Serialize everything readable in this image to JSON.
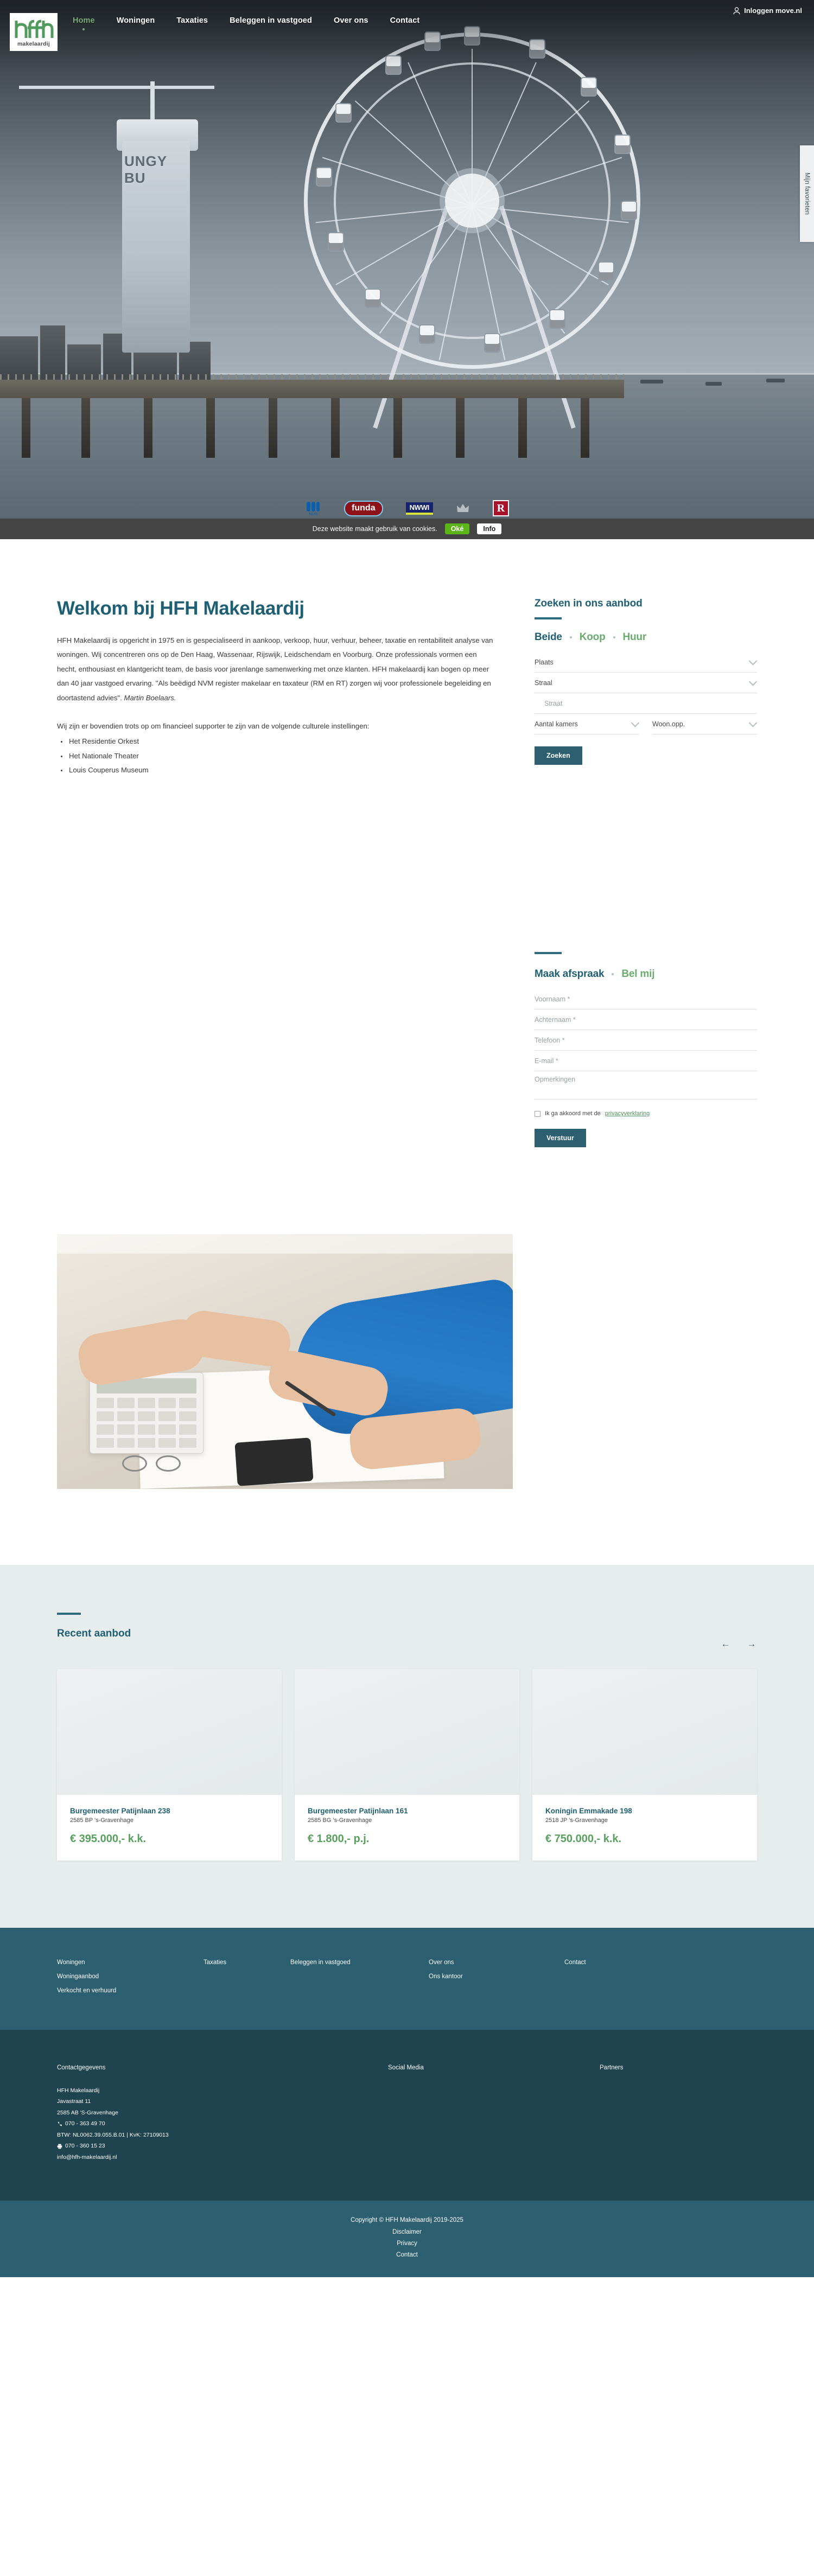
{
  "site": {
    "logo_mark": "hfh",
    "logo_word": "makelaardij"
  },
  "nav": {
    "items": [
      {
        "label": "Home",
        "active": true
      },
      {
        "label": "Woningen",
        "active": false
      },
      {
        "label": "Taxaties",
        "active": false
      },
      {
        "label": "Beleggen in vastgoed",
        "active": false
      },
      {
        "label": "Over ons",
        "active": false
      },
      {
        "label": "Contact",
        "active": false
      }
    ],
    "login_label": "Inloggen move.nl",
    "login_icon": "user-icon"
  },
  "favorites_tab": {
    "label": "Mijn favorieten"
  },
  "hero": {
    "tower_text": "UNGY BU",
    "partners": [
      {
        "name": "NVM",
        "type": "nvm"
      },
      {
        "name": "funda",
        "type": "funda"
      },
      {
        "name": "NWWI",
        "type": "nwwi"
      },
      {
        "name": "vastgoedcert gecertificeerd",
        "type": "vgc"
      },
      {
        "name": "R",
        "type": "r"
      }
    ]
  },
  "cookiebar": {
    "text": "Deze website maakt gebruik van cookies.",
    "ok_label": "Oké",
    "info_label": "Info"
  },
  "welcome": {
    "title": "Welkom bij HFH Makelaardij",
    "paragraph": "HFH Makelaardij is opgericht in 1975 en is gespecialiseerd in aankoop, verkoop, huur, verhuur, beheer, taxatie en rentabiliteit analyse van woningen. Wij concentreren ons op de Den Haag, Wassenaar, Rijswijk, Leidschendam en Voorburg. Onze professionals vormen een hecht, enthousiast en klantgericht team, de basis voor jarenlange samenwerking met onze klanten. HFH makelaardij kan bogen op meer dan 40 jaar vastgoed ervaring. \"Als beëdigd NVM register makelaar en taxateur (RM en RT) zorgen wij voor professionele begeleiding en doortastend advies\". ",
    "signature": "Martin Boelaars.",
    "culture_intro": "Wij zijn er bovendien trots op om financieel supporter te zijn van de volgende culturele instellingen:",
    "culture_items": [
      "Het Residentie Orkest",
      "Het Nationale Theater",
      "Louis Couperus Museum"
    ]
  },
  "search_widget": {
    "title": "Zoeken in ons aanbod",
    "tabs": [
      {
        "label": "Beide",
        "selected": true
      },
      {
        "label": "Koop",
        "selected": false
      },
      {
        "label": "Huur",
        "selected": false
      }
    ],
    "fields": {
      "plaats": "Plaats",
      "straal": "Straal",
      "straat_placeholder": "Straat",
      "kamers": "Aantal kamers",
      "woonopp": "Woon.opp."
    },
    "submit_label": "Zoeken"
  },
  "appointment_widget": {
    "tabs": [
      {
        "label": "Maak afspraak",
        "selected": true
      },
      {
        "label": "Bel mij",
        "selected": false
      }
    ],
    "fields": {
      "voornaam": "Voornaam *",
      "achternaam": "Achternaam *",
      "telefoon": "Telefoon *",
      "email": "E-mail *",
      "opmerkingen": "Opmerkingen"
    },
    "consent_text": "Ik ga akkoord met de",
    "consent_link": "privacyverklaring",
    "submit_label": "Verstuur"
  },
  "recent": {
    "title": "Recent aanbod",
    "prev_icon": "arrow-left-icon",
    "next_icon": "arrow-right-icon",
    "cards": [
      {
        "address": "Burgemeester Patijnlaan 238",
        "zip": "2585 BP 's-Gravenhage",
        "price": "€ 395.000,- k.k."
      },
      {
        "address": "Burgemeester Patijnlaan 161",
        "zip": "2585 BG 's-Gravenhage",
        "price": "€ 1.800,- p.j."
      },
      {
        "address": "Koningin Emmakade 198",
        "zip": "2518 JP 's-Gravenhage",
        "price": "€ 750.000,- k.k."
      }
    ]
  },
  "footer_nav": {
    "columns": [
      {
        "links": [
          "Woningen",
          "Woningaanbod",
          "Verkocht en verhuurd"
        ]
      },
      {
        "links": [
          "Taxaties"
        ]
      },
      {
        "links": [
          "Beleggen in vastgoed"
        ]
      },
      {
        "links": [
          "Over ons",
          "Ons kantoor"
        ]
      },
      {
        "links": [
          "Contact"
        ]
      }
    ]
  },
  "footer_contact": {
    "heading_contact": "Contactgegevens",
    "heading_social": "Social Media",
    "heading_partners": "Partners",
    "company": "HFH Makelaardij",
    "street": "Javastraat 11",
    "city": "2585 AB 'S-Gravenhage",
    "phone": "070 - 363 49 70",
    "phone_icon": "phone-icon",
    "btw": "BTW: NL0062.39.055.B.01 | KvK: 27109013",
    "fax": "070 - 360 15 23",
    "fax_icon": "fax-icon",
    "email": "info@hfh-makelaardij.nl"
  },
  "footer_bottom": {
    "copyright": "Copyright © HFH Makelaardij 2019-2025",
    "links": [
      "Disclaimer",
      "Privacy",
      "Contact"
    ]
  },
  "colors": {
    "brand_teal": "#2c5f70",
    "brand_dark": "#1f4450",
    "heading_teal": "#1f5f73",
    "accent_green": "#57a05d",
    "cookie_green": "#5cb516",
    "panel_grey": "#e7eced"
  }
}
